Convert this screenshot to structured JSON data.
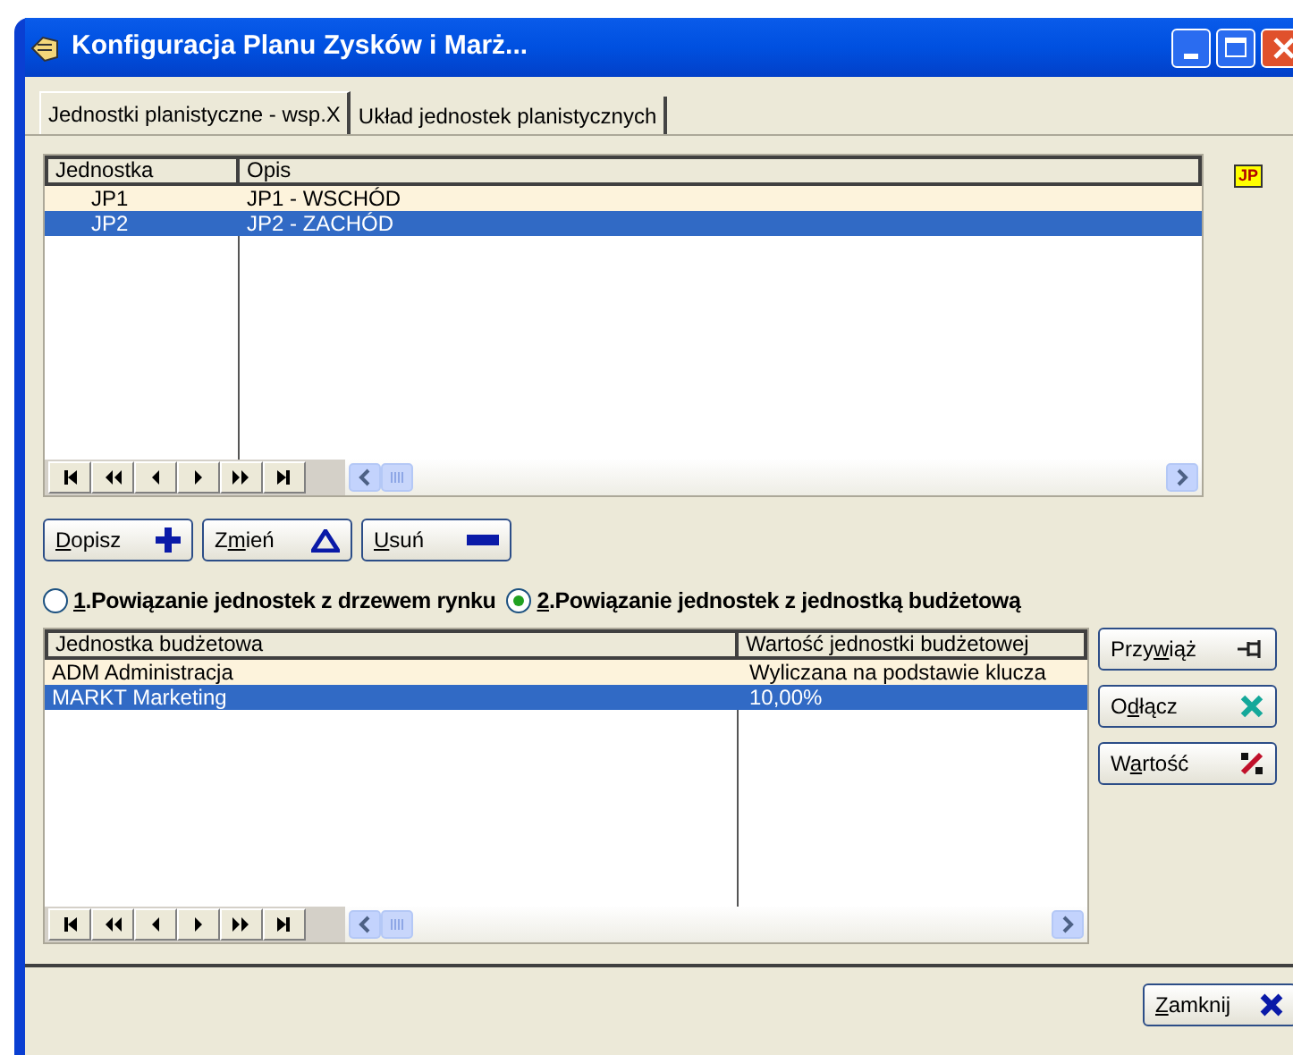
{
  "window": {
    "title": "Konfiguracja Planu Zysków i Marż..."
  },
  "tabs": [
    {
      "label": "Jednostki planistyczne - wsp.X",
      "selected": true
    },
    {
      "label": "Układ jednostek planistycznych",
      "selected": false
    }
  ],
  "units_table": {
    "columns": [
      "Jednostka",
      "Opis"
    ],
    "rows": [
      {
        "cells": [
          "JP1",
          "JP1 - WSCHÓD"
        ],
        "selected": false
      },
      {
        "cells": [
          "JP2",
          "JP2 - ZACHÓD"
        ],
        "selected": true
      }
    ]
  },
  "side_badge": "JP",
  "unit_buttons": [
    {
      "key": "D",
      "after": "opisz",
      "kind": "add"
    },
    {
      "before": "Z",
      "key": "m",
      "after": "ień",
      "kind": "change"
    },
    {
      "key": "U",
      "after": "suń",
      "kind": "remove"
    }
  ],
  "link_options": [
    {
      "key": "1",
      "after": ".Powiązanie jednostek z drzewem rynku",
      "selected": false
    },
    {
      "key": "2",
      "after": ".Powiązanie jednostek z jednostką budżetową",
      "selected": true
    }
  ],
  "budget_table": {
    "columns": [
      "Jednostka budżetowa",
      "Wartość jednostki budżetowej"
    ],
    "rows": [
      {
        "cells": [
          "ADM Administracja",
          "Wyliczana na podstawie klucza"
        ],
        "selected": false
      },
      {
        "cells": [
          "MARKT Marketing",
          "10,00%"
        ],
        "selected": true
      }
    ]
  },
  "budget_buttons": [
    {
      "before": "Przy",
      "key": "w",
      "after": "iąż",
      "kind": "attach"
    },
    {
      "before": "O",
      "key": "d",
      "after": "łącz",
      "kind": "detach"
    },
    {
      "before": "W",
      "key": "a",
      "after": "rtość",
      "kind": "value"
    }
  ],
  "close_button": {
    "key": "Z",
    "after": "amknij",
    "kind": "close"
  }
}
